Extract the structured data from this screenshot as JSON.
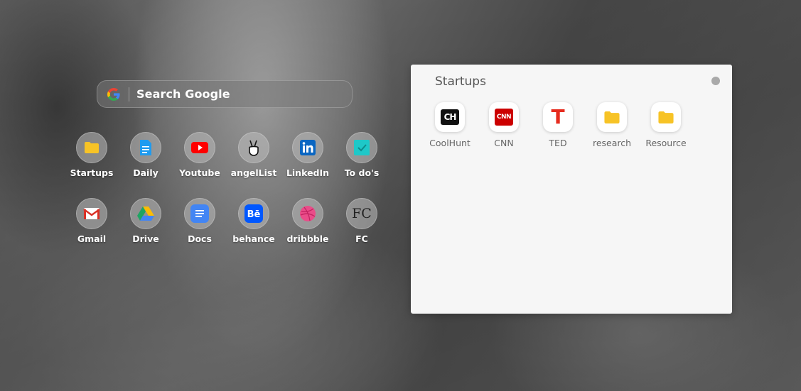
{
  "search": {
    "label": "Search Google"
  },
  "shortcuts": [
    {
      "label": "Startups",
      "icon": "folder-icon",
      "color": "#f7c326"
    },
    {
      "label": "Daily",
      "icon": "document-icon",
      "color": "#1e9bf0"
    },
    {
      "label": "Youtube",
      "icon": "youtube-icon",
      "color": "#ff0000"
    },
    {
      "label": "angelList",
      "icon": "peace-hand-icon",
      "color": "#000000"
    },
    {
      "label": "LinkedIn",
      "icon": "linkedin-icon",
      "color": "#0a66c2"
    },
    {
      "label": "To do's",
      "icon": "todo-check-icon",
      "color": "#1ec8c8"
    },
    {
      "label": "Gmail",
      "icon": "gmail-icon",
      "color": "#d93025"
    },
    {
      "label": "Drive",
      "icon": "drive-icon",
      "color": "#1fa463"
    },
    {
      "label": "Docs",
      "icon": "docs-icon",
      "color": "#4285f4"
    },
    {
      "label": "behance",
      "icon": "behance-icon",
      "color": "#0057ff"
    },
    {
      "label": "dribbble",
      "icon": "dribbble-icon",
      "color": "#ea4c89"
    },
    {
      "label": "FC",
      "icon": "fc-text-icon",
      "color": "#222222"
    }
  ],
  "panel": {
    "title": "Startups",
    "items": [
      {
        "label": "CoolHunt",
        "icon": "coolhunt-icon",
        "icon_text": "CH"
      },
      {
        "label": "CNN",
        "icon": "cnn-icon",
        "icon_text": "CNN"
      },
      {
        "label": "TED",
        "icon": "ted-icon",
        "icon_text": "T"
      },
      {
        "label": "research",
        "icon": "folder-icon",
        "icon_text": ""
      },
      {
        "label": "Resource",
        "icon": "folder-icon",
        "icon_text": ""
      }
    ]
  },
  "fc_glyph": "FC"
}
